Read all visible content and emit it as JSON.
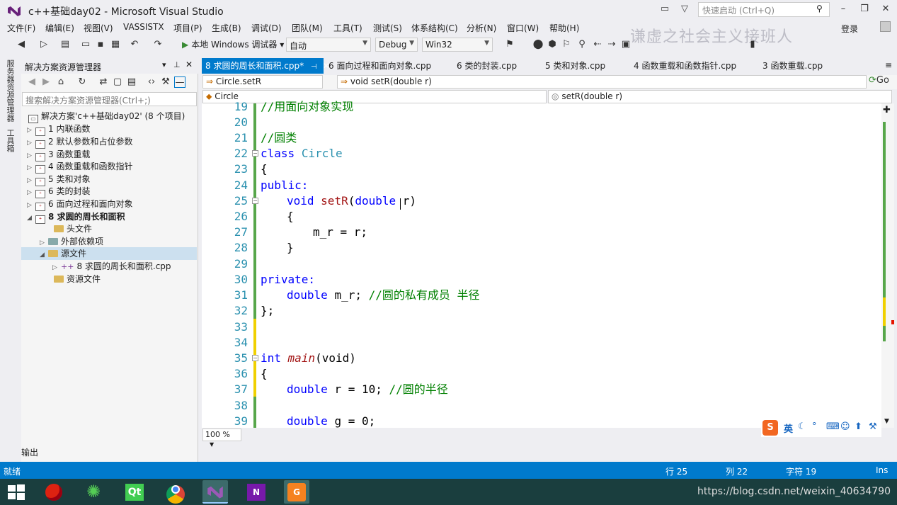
{
  "window": {
    "title": "c++基础day02 - Microsoft Visual Studio",
    "quick_launch_placeholder": "快速启动 (Ctrl+Q)",
    "login": "登录",
    "watermark": "谦虚之社会主义接班人"
  },
  "menu": [
    "文件(F)",
    "编辑(E)",
    "视图(V)",
    "VASSISTX",
    "项目(P)",
    "生成(B)",
    "调试(D)",
    "团队(M)",
    "工具(T)",
    "测试(S)",
    "体系结构(C)",
    "分析(N)",
    "窗口(W)",
    "帮助(H)"
  ],
  "toolbar": {
    "run_label": "本地 Windows 调试器",
    "config1": "自动",
    "config2": "Debug",
    "platform": "Win32"
  },
  "side_tabs": [
    "服务器资源管理器",
    "工具箱"
  ],
  "solution_explorer": {
    "title": "解决方案资源管理器",
    "search_placeholder": "搜索解决方案资源管理器(Ctrl+;)",
    "solution": "解决方案'c++基础day02' (8 个项目)",
    "projects": [
      "1 内联函数",
      "2 默认参数和占位参数",
      "3 函数重载",
      "4 函数重载和函数指针",
      "5 类和对象",
      "6 类的封装",
      "6 面向过程和面向对象",
      "8 求圆的周长和面积"
    ],
    "children": [
      "头文件",
      "外部依赖项",
      "源文件"
    ],
    "file": "8 求圆的周长和面积.cpp",
    "resource": "资源文件"
  },
  "doc_tabs": [
    "8 求圆的周长和面积.cpp*",
    "6 面向过程和面向对象.cpp",
    "6 类的封装.cpp",
    "5 类和对象.cpp",
    "4 函数重载和函数指针.cpp",
    "3 函数重载.cpp"
  ],
  "nav": {
    "scope": "Circle.setR",
    "member": "void setR(double r)",
    "class": "Circle",
    "method": "setR(double r)",
    "go": "Go"
  },
  "code": {
    "line_numbers": [
      "19",
      "20",
      "21",
      "22",
      "23",
      "24",
      "25",
      "26",
      "27",
      "28",
      "29",
      "30",
      "31",
      "32",
      "33",
      "34",
      "35",
      "36",
      "37",
      "38",
      "39"
    ],
    "l19": "//用面向对象实现",
    "l21": "//圆类",
    "l22a": "class",
    "l22b": "Circle",
    "l23": "{",
    "l24": "public:",
    "l25a": "void",
    "l25b": "setR",
    "l25c": "(",
    "l25d": "double",
    "l25e": "r)",
    "l26": "{",
    "l27": "m_r = r;",
    "l28": "}",
    "l30": "private:",
    "l31a": "double",
    "l31b": "m_r;",
    "l31c": "//圆的私有成员 半径",
    "l32": "};",
    "l35a": "int",
    "l35b": "main",
    "l35c": "(void)",
    "l36": "{",
    "l37a": "double",
    "l37b": "r = 10;",
    "l37c": "//圆的半径",
    "l39a": "double",
    "l39b": "g = 0;"
  },
  "zoom": "100 %",
  "ime": "英",
  "output_label": "输出",
  "status": {
    "ready": "就绪",
    "row": "行 25",
    "col": "列 22",
    "char": "字符 19",
    "mode": "Ins"
  },
  "taskbar_url": "https://blog.csdn.net/weixin_40634790",
  "colors": {
    "accent": "#007acc",
    "keyword": "#0000ff",
    "comment": "#008000",
    "linenumber": "#2b91af"
  }
}
